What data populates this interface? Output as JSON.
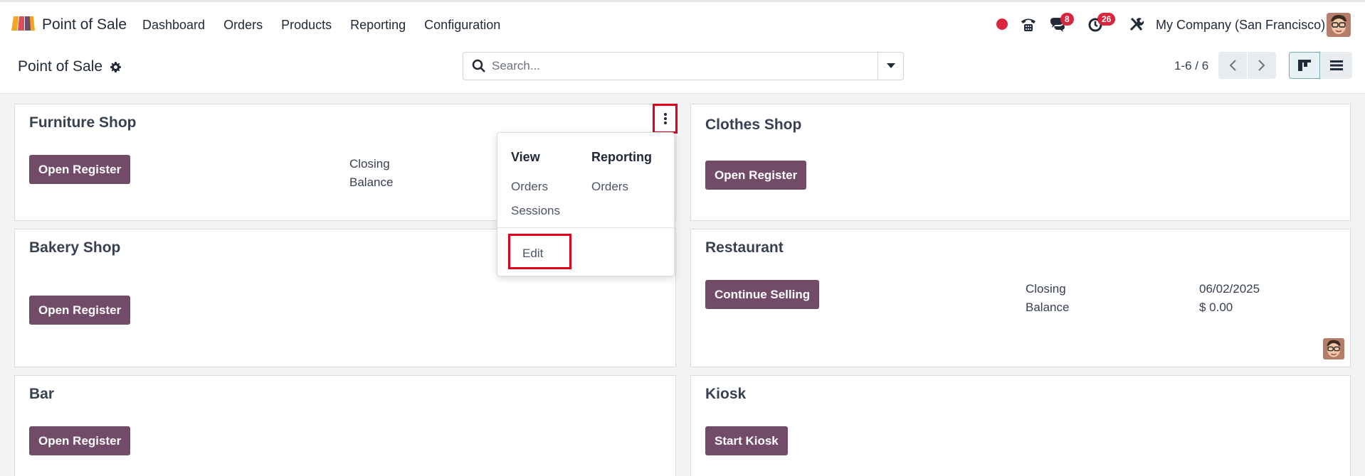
{
  "navbar": {
    "app_name": "Point of Sale",
    "menu": [
      "Dashboard",
      "Orders",
      "Products",
      "Reporting",
      "Configuration"
    ],
    "chat_badge": "8",
    "activity_badge": "26",
    "company": "My Company (San Francisco)"
  },
  "control_panel": {
    "breadcrumb": "Point of Sale",
    "search_placeholder": "Search...",
    "pager": "1-6 / 6"
  },
  "cards": {
    "furniture": {
      "title": "Furniture Shop",
      "button": "Open Register",
      "closing_label": "Closing",
      "balance_label": "Balance"
    },
    "clothes": {
      "title": "Clothes Shop",
      "button": "Open Register"
    },
    "bakery": {
      "title": "Bakery Shop",
      "button": "Open Register"
    },
    "restaurant": {
      "title": "Restaurant",
      "button": "Continue Selling",
      "closing_label": "Closing",
      "balance_label": "Balance",
      "closing_value": "06/02/2025",
      "balance_value": "$ 0.00"
    },
    "bar": {
      "title": "Bar",
      "button": "Open Register"
    },
    "kiosk": {
      "title": "Kiosk",
      "button": "Start Kiosk"
    }
  },
  "dropdown": {
    "view_header": "View",
    "reporting_header": "Reporting",
    "view_orders": "Orders",
    "view_sessions": "Sessions",
    "reporting_orders": "Orders",
    "edit": "Edit"
  },
  "colors": {
    "primary": "#714b67",
    "highlight": "#e0001a",
    "badge": "#d7263d"
  }
}
